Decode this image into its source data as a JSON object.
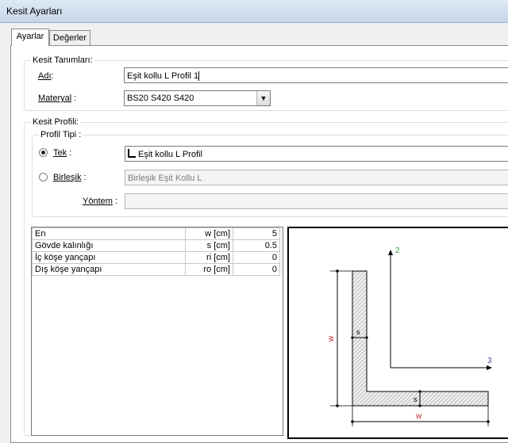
{
  "window": {
    "title": "Kesit Ayarları"
  },
  "tabs": [
    {
      "label": "Ayarlar",
      "active": true
    },
    {
      "label": "Değerler",
      "active": false
    }
  ],
  "section_def": {
    "legend": "Kesit Tanımları",
    "name_label": "Adı",
    "name_value": "Eşit kollu L Profil 1",
    "material_label": "Materyal",
    "material_value": "BS20 S420 S420"
  },
  "section_profile": {
    "legend": "Kesit Profili",
    "profile_type": {
      "legend": "Profil Tipi",
      "single_label": "Tek",
      "single_selected": true,
      "single_value": "Eşit kollu L Profil",
      "single_icon": "l-profile-icon",
      "compound_label": "Birleşik",
      "compound_selected": false,
      "compound_value": "Birleşik Eşit Kollu L"
    },
    "method_label": "Yöntem",
    "method_value": ""
  },
  "params": {
    "rows": [
      {
        "name": "En",
        "symbol": "w [cm]",
        "value": "5"
      },
      {
        "name": "Gövde kalınlığı",
        "symbol": "s [cm]",
        "value": "0.5"
      },
      {
        "name": "İç köşe yançapı",
        "symbol": "ri [cm]",
        "value": "0"
      },
      {
        "name": "Dış köşe yançapı",
        "symbol": "ro [cm]",
        "value": "0"
      }
    ]
  },
  "diagram": {
    "axis_y_label": "2",
    "axis_x_label": "3",
    "dim_w_vertical": "w",
    "dim_w_horizontal": "w",
    "dim_s_web": "s",
    "dim_s_flange": "s",
    "colors": {
      "axis_y_label": "#2e9a3e",
      "axis_x_label": "#3a4bb0",
      "dim_w": "#c0282b"
    }
  }
}
